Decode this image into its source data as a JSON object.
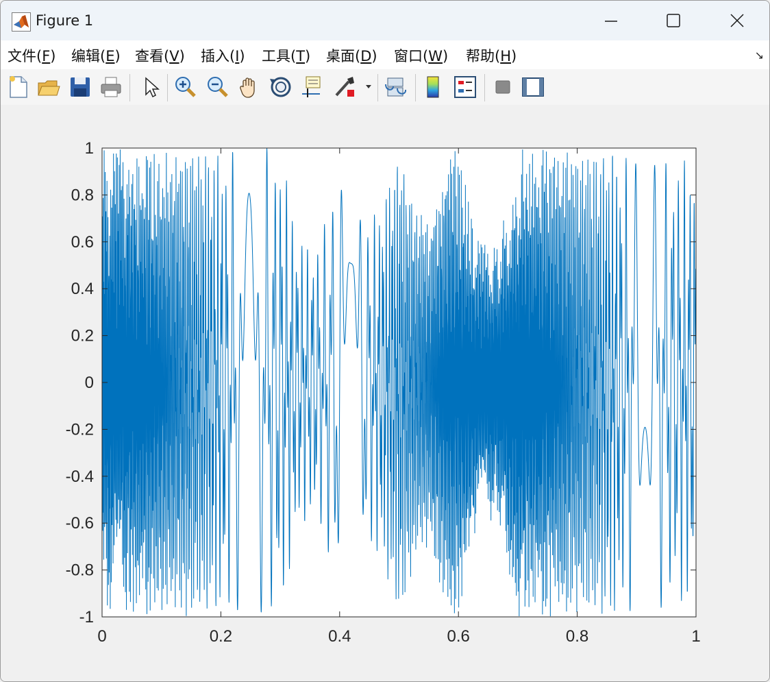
{
  "window": {
    "title": "Figure 1",
    "icon": "matlab-logo-icon",
    "controls": [
      "minimize-icon",
      "maximize-icon",
      "close-icon"
    ]
  },
  "menubar": {
    "items": [
      {
        "label": "文件(",
        "hotkey": "F",
        "suffix": ")"
      },
      {
        "label": "编辑(",
        "hotkey": "E",
        "suffix": ")"
      },
      {
        "label": "查看(",
        "hotkey": "V",
        "suffix": ")"
      },
      {
        "label": "插入(",
        "hotkey": "I",
        "suffix": ")"
      },
      {
        "label": "工具(",
        "hotkey": "T",
        "suffix": ")"
      },
      {
        "label": "桌面(",
        "hotkey": "D",
        "suffix": ")"
      },
      {
        "label": "窗口(",
        "hotkey": "W",
        "suffix": ")"
      },
      {
        "label": "帮助(",
        "hotkey": "H",
        "suffix": ")"
      }
    ],
    "dock_arrow": "↘"
  },
  "toolbar": {
    "buttons": [
      "new-figure-icon",
      "open-file-icon",
      "save-icon",
      "print-icon",
      "select-pointer-icon",
      "zoom-in-icon",
      "zoom-out-icon",
      "pan-hand-icon",
      "rotate-3d-icon",
      "data-cursor-icon",
      "brush-icon",
      "brush-dropdown-icon",
      "link-plot-icon",
      "colorbar-icon",
      "legend-icon",
      "hide-plot-tools-icon",
      "show-plot-tools-icon"
    ]
  },
  "chart_data": {
    "type": "line",
    "title": "",
    "xlabel": "",
    "ylabel": "",
    "xlim": [
      0,
      1
    ],
    "ylim": [
      -1,
      1
    ],
    "xticks": [
      "0",
      "0.2",
      "0.4",
      "0.6",
      "0.8",
      "1"
    ],
    "yticks": [
      "1",
      "0.8",
      "0.6",
      "0.4",
      "0.2",
      "0",
      "-0.2",
      "-0.4",
      "-0.6",
      "-0.8",
      "-1"
    ],
    "grid": false,
    "series": [
      {
        "color": "#0072bd",
        "description_formula": "chirp-like high-frequency oscillation with envelope amplitude varying between ~0.55 and 1",
        "samples": 1001,
        "envelope_points": [
          [
            0.0,
            1.0
          ],
          [
            0.05,
            1.0
          ],
          [
            0.1,
            0.98
          ],
          [
            0.15,
            1.0
          ],
          [
            0.2,
            0.98
          ],
          [
            0.25,
            1.0
          ],
          [
            0.3,
            1.0
          ],
          [
            0.33,
            0.62
          ],
          [
            0.35,
            0.58
          ],
          [
            0.37,
            0.62
          ],
          [
            0.4,
            1.0
          ],
          [
            0.42,
            0.98
          ],
          [
            0.45,
            0.7
          ],
          [
            0.47,
            0.75
          ],
          [
            0.5,
            1.0
          ],
          [
            0.53,
            0.75
          ],
          [
            0.55,
            0.7
          ],
          [
            0.58,
            0.98
          ],
          [
            0.6,
            1.0
          ],
          [
            0.63,
            0.62
          ],
          [
            0.65,
            0.58
          ],
          [
            0.67,
            0.62
          ],
          [
            0.7,
            1.0
          ],
          [
            0.75,
            1.0
          ],
          [
            0.8,
            0.98
          ],
          [
            0.85,
            1.0
          ],
          [
            0.9,
            0.97
          ],
          [
            0.95,
            0.96
          ],
          [
            1.0,
            0.94
          ]
        ]
      }
    ]
  }
}
